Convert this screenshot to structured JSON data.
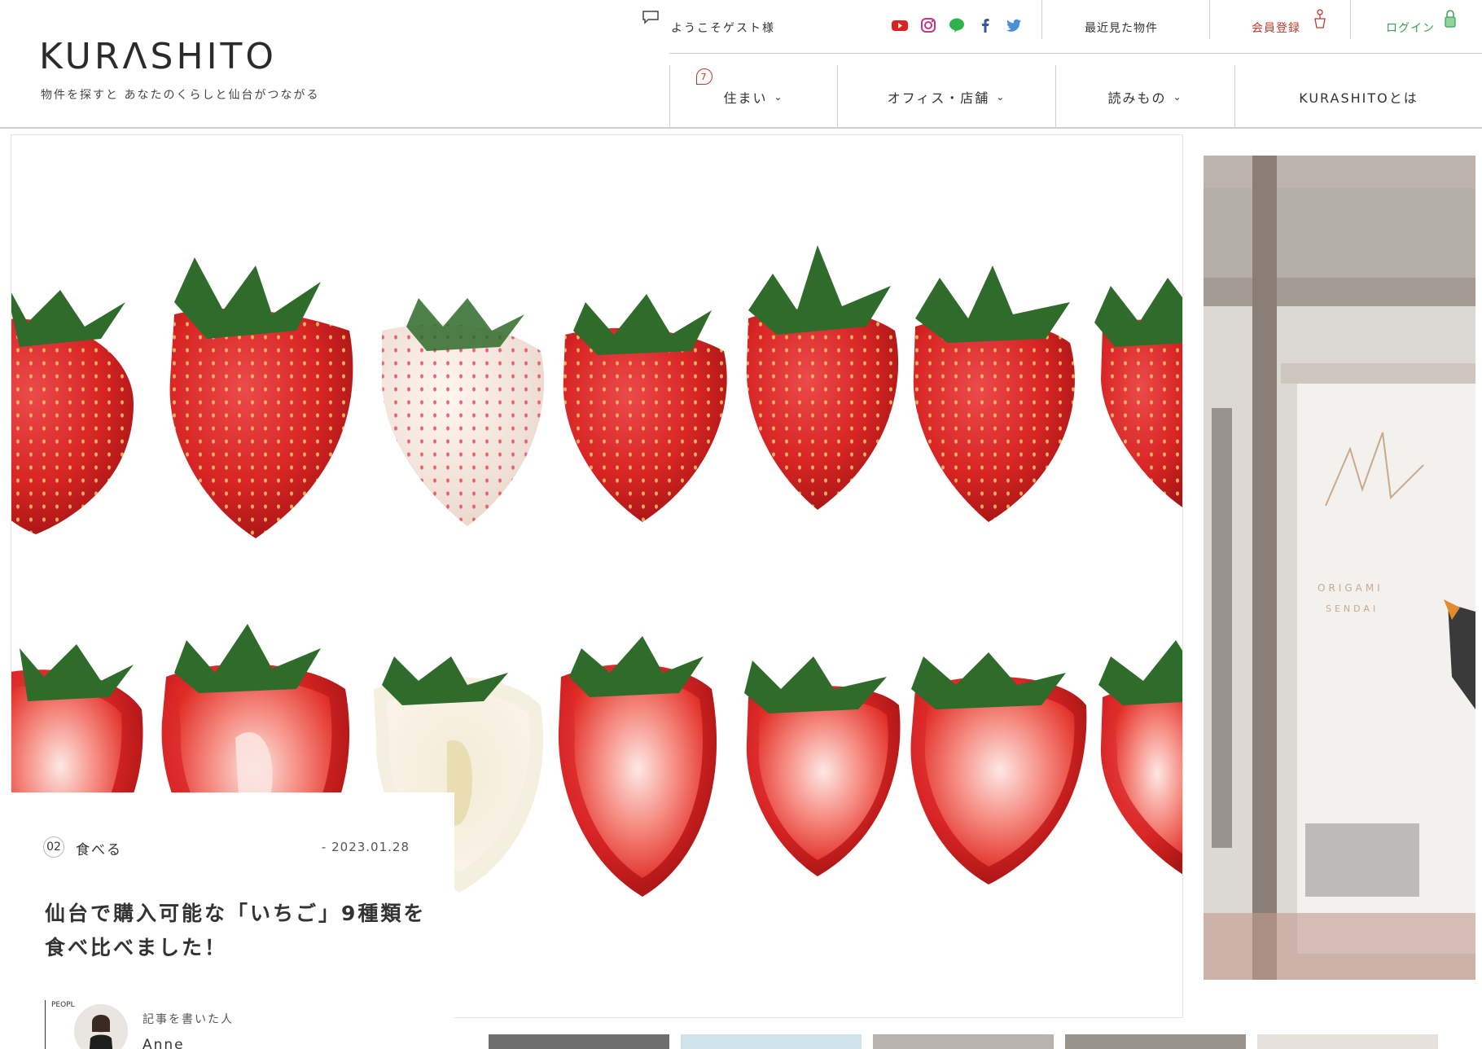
{
  "header": {
    "logo": "KURΛSHITO",
    "tagline": "物件を探すと あなたのくらしと仙台がつながる",
    "welcome": "ようこそゲスト様",
    "recent": "最近見た物件",
    "register": "会員登録",
    "login": "ログイン",
    "social": [
      "youtube-icon",
      "instagram-icon",
      "line-icon",
      "facebook-icon",
      "twitter-icon"
    ]
  },
  "nav": {
    "items": [
      {
        "label": "住まい",
        "badge": "7"
      },
      {
        "label": "オフィス・店舗"
      },
      {
        "label": "読みもの"
      },
      {
        "label": "KURASHITOとは"
      }
    ]
  },
  "article": {
    "number": "02",
    "category": "食べる",
    "date": "- 2023.01.28",
    "title": "仙台で購入可能な「いちご」9種類を食べ比べました！",
    "people_label": "PEOPL",
    "writer_label": "記事を書いた人",
    "writer_name": "Anne"
  },
  "side": {
    "sign": "ORIGAMI SENDAI"
  },
  "colors": {
    "accent_red": "#c0392b",
    "accent_green": "#3aa352",
    "strawberry": "#d92b2b"
  }
}
